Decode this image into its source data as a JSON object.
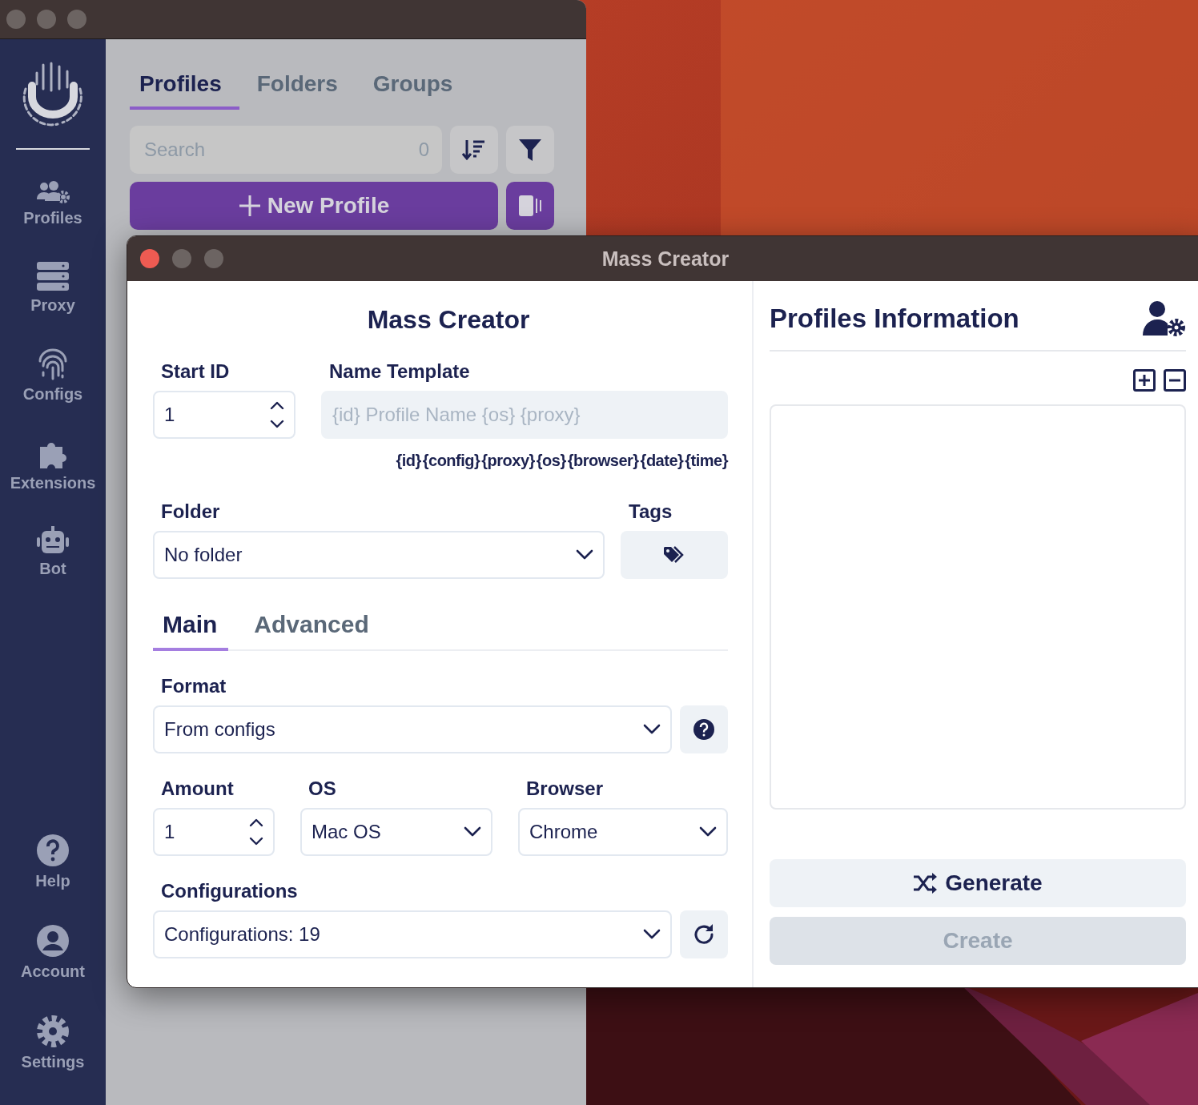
{
  "sidebar": {
    "items": [
      {
        "label": "Profiles"
      },
      {
        "label": "Proxy"
      },
      {
        "label": "Configs"
      },
      {
        "label": "Extensions"
      },
      {
        "label": "Bot"
      }
    ],
    "bottom_items": [
      {
        "label": "Help"
      },
      {
        "label": "Account"
      },
      {
        "label": "Settings"
      }
    ]
  },
  "tabs": [
    {
      "label": "Profiles",
      "selected": true
    },
    {
      "label": "Folders",
      "selected": false
    },
    {
      "label": "Groups",
      "selected": false
    }
  ],
  "search": {
    "placeholder": "Search",
    "count": "0"
  },
  "new_profile_button": {
    "label": "New Profile"
  },
  "dialog": {
    "title": "Mass Creator",
    "heading": "Mass Creator",
    "start_id": {
      "label": "Start ID",
      "value": "1"
    },
    "name_template": {
      "label": "Name Template",
      "placeholder": "{id} Profile Name {os} {proxy}",
      "tokens": [
        "{id}",
        "{config}",
        "{proxy}",
        "{os}",
        "{browser}",
        "{date}",
        "{time}"
      ]
    },
    "folder": {
      "label": "Folder",
      "value": "No folder"
    },
    "tags": {
      "label": "Tags"
    },
    "tabs": [
      {
        "label": "Main",
        "selected": true
      },
      {
        "label": "Advanced",
        "selected": false
      }
    ],
    "format": {
      "label": "Format",
      "value": "From configs"
    },
    "amount": {
      "label": "Amount",
      "value": "1"
    },
    "os": {
      "label": "OS",
      "value": "Mac OS"
    },
    "browser": {
      "label": "Browser",
      "value": "Chrome"
    },
    "configurations": {
      "label": "Configurations",
      "value": "Configurations: 19"
    },
    "info_panel": {
      "title": "Profiles Information"
    },
    "generate_button": {
      "label": "Generate"
    },
    "create_button": {
      "label": "Create",
      "disabled": true
    }
  }
}
